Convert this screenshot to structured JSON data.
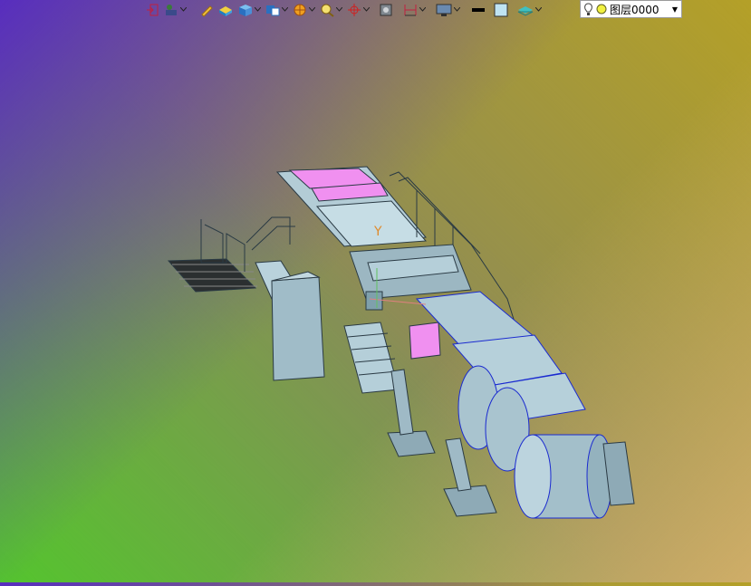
{
  "toolbar": {
    "items": [
      {
        "name": "exit-sketch-icon",
        "has_menu": false
      },
      {
        "name": "assembly-tool-icon",
        "has_menu": true
      },
      {
        "name": "pencil-icon",
        "has_menu": false
      },
      {
        "name": "part-color-icon",
        "has_menu": false
      },
      {
        "name": "cube-icon",
        "has_menu": true
      },
      {
        "name": "view-orientation-icon",
        "has_menu": true
      },
      {
        "name": "section-view-icon",
        "has_menu": true
      },
      {
        "name": "zoom-area-icon",
        "has_menu": true
      },
      {
        "name": "triad-icon",
        "has_menu": true
      },
      {
        "name": "render-icon",
        "has_menu": false
      },
      {
        "name": "dimension-icon",
        "has_menu": true
      },
      {
        "name": "monitor-icon",
        "has_menu": true
      },
      {
        "name": "line-style-icon",
        "has_menu": false
      },
      {
        "name": "fill-color-icon",
        "has_menu": false
      },
      {
        "name": "layer-icon",
        "has_menu": true
      }
    ]
  },
  "layer": {
    "selected": "图层0000"
  },
  "viewport": {
    "axis_label": "Y"
  },
  "colors": {
    "model_fill": "#a8c8d4",
    "model_stroke": "#2a3a44",
    "highlight_pink": "#f090f0",
    "edge_blue": "#1a2ad0"
  }
}
